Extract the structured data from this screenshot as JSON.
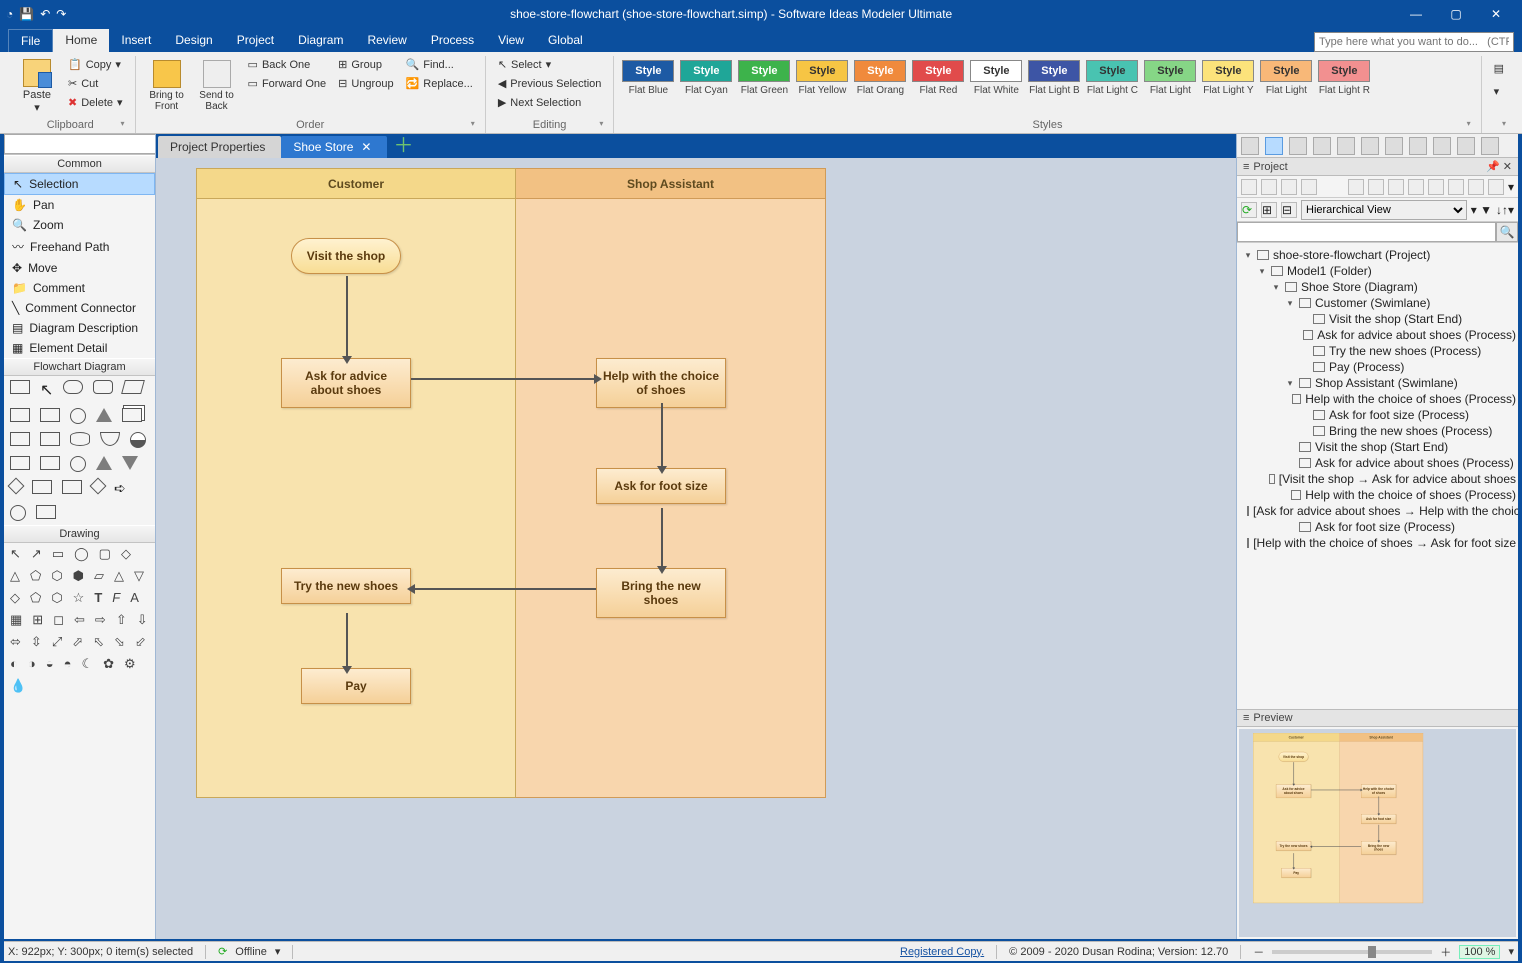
{
  "title": "shoe-store-flowchart (shoe-store-flowchart.simp) - Software Ideas Modeler Ultimate",
  "menus": {
    "items": [
      "File",
      "Home",
      "Insert",
      "Design",
      "Project",
      "Diagram",
      "Review",
      "Process",
      "View",
      "Global"
    ],
    "active": "Home"
  },
  "search_placeholder": "Type here what you want to do...   (CTRL+Q)",
  "ribbon": {
    "clipboard": {
      "paste": "Paste",
      "copy": "Copy",
      "cut": "Cut",
      "delete": "Delete",
      "label": "Clipboard"
    },
    "order": {
      "bring_front": "Bring to Front",
      "send_back": "Send to Back",
      "back_one": "Back One",
      "forward_one": "Forward One",
      "group": "Group",
      "ungroup": "Ungroup",
      "find": "Find...",
      "replace": "Replace...",
      "label": "Order"
    },
    "editing": {
      "select": "Select",
      "prev_sel": "Previous Selection",
      "next_sel": "Next Selection",
      "label": "Editing"
    },
    "styles": {
      "list": [
        {
          "bg": "#1D5AA4",
          "fg": "#fff",
          "name": "Flat Blue"
        },
        {
          "bg": "#1FA698",
          "fg": "#fff",
          "name": "Flat Cyan"
        },
        {
          "bg": "#3DB34B",
          "fg": "#fff",
          "name": "Flat Green"
        },
        {
          "bg": "#F6C544",
          "fg": "#333",
          "name": "Flat Yellow"
        },
        {
          "bg": "#F08A3C",
          "fg": "#fff",
          "name": "Flat Orang"
        },
        {
          "bg": "#E14B4B",
          "fg": "#fff",
          "name": "Flat Red"
        },
        {
          "bg": "#FFFFFF",
          "fg": "#333",
          "name": "Flat White"
        },
        {
          "bg": "#3D55A5",
          "fg": "#fff",
          "name": "Flat Light B"
        },
        {
          "bg": "#49C3B1",
          "fg": "#333",
          "name": "Flat Light C"
        },
        {
          "bg": "#86D686",
          "fg": "#333",
          "name": "Flat Light"
        },
        {
          "bg": "#FCE37B",
          "fg": "#333",
          "name": "Flat Light Y"
        },
        {
          "bg": "#F8B878",
          "fg": "#333",
          "name": "Flat Light"
        },
        {
          "bg": "#F29090",
          "fg": "#333",
          "name": "Flat Light R"
        }
      ],
      "chip_label": "Style",
      "label": "Styles"
    }
  },
  "left_tools": {
    "common_hdr": "Common",
    "common": [
      "Selection",
      "Pan",
      "Zoom",
      "Freehand Path",
      "Move",
      "Comment",
      "Comment Connector",
      "Diagram Description",
      "Element Detail"
    ],
    "flow_hdr": "Flowchart Diagram",
    "draw_hdr": "Drawing",
    "selected": "Selection"
  },
  "doc_tabs": {
    "inactive": "Project Properties",
    "active": "Shoe Store"
  },
  "flowchart": {
    "lanes": [
      {
        "title": "Customer"
      },
      {
        "title": "Shop Assistant"
      }
    ],
    "nodes": {
      "visit": "Visit the shop",
      "ask_advice": "Ask for advice about shoes",
      "help": "Help with the choice of shoes",
      "foot": "Ask for foot size",
      "bring": "Bring the new shoes",
      "try": "Try the new shoes",
      "pay": "Pay"
    }
  },
  "right": {
    "project_hdr": "Project",
    "view_mode": "Hierarchical View",
    "tree": [
      {
        "indent": 0,
        "tw": "▾",
        "text": "shoe-store-flowchart (Project)"
      },
      {
        "indent": 1,
        "tw": "▾",
        "text": "Model1 (Folder)"
      },
      {
        "indent": 2,
        "tw": "▾",
        "text": "Shoe Store (Diagram)"
      },
      {
        "indent": 3,
        "tw": "▾",
        "text": "Customer (Swimlane)"
      },
      {
        "indent": 4,
        "tw": "",
        "text": "Visit the shop (Start End)"
      },
      {
        "indent": 4,
        "tw": "",
        "text": "Ask for advice about shoes (Process)"
      },
      {
        "indent": 4,
        "tw": "",
        "text": "Try the new shoes (Process)"
      },
      {
        "indent": 4,
        "tw": "",
        "text": "Pay (Process)"
      },
      {
        "indent": 3,
        "tw": "▾",
        "text": "Shop Assistant (Swimlane)"
      },
      {
        "indent": 4,
        "tw": "",
        "text": "Help with the choice of shoes (Process)"
      },
      {
        "indent": 4,
        "tw": "",
        "text": "Ask for foot size (Process)"
      },
      {
        "indent": 4,
        "tw": "",
        "text": "Bring the new shoes (Process)"
      },
      {
        "indent": 3,
        "tw": "",
        "text": "Visit the shop (Start End)"
      },
      {
        "indent": 3,
        "tw": "",
        "text": "Ask for advice about shoes (Process)"
      },
      {
        "indent": 3,
        "tw": "",
        "text": "[Visit the shop → Ask for advice about shoes"
      },
      {
        "indent": 3,
        "tw": "",
        "text": "Help with the choice of shoes (Process)"
      },
      {
        "indent": 3,
        "tw": "",
        "text": "[Ask for advice about shoes → Help with the choice"
      },
      {
        "indent": 3,
        "tw": "",
        "text": "Ask for foot size (Process)"
      },
      {
        "indent": 3,
        "tw": "",
        "text": "[Help with the choice of shoes → Ask for foot size"
      }
    ],
    "preview_hdr": "Preview"
  },
  "status": {
    "pos": "X: 922px; Y: 300px; 0 item(s) selected",
    "offline": "Offline",
    "registered": "Registered Copy.",
    "copyright": "© 2009 - 2020 Dusan Rodina; Version: 12.70",
    "zoom": "100 %"
  }
}
